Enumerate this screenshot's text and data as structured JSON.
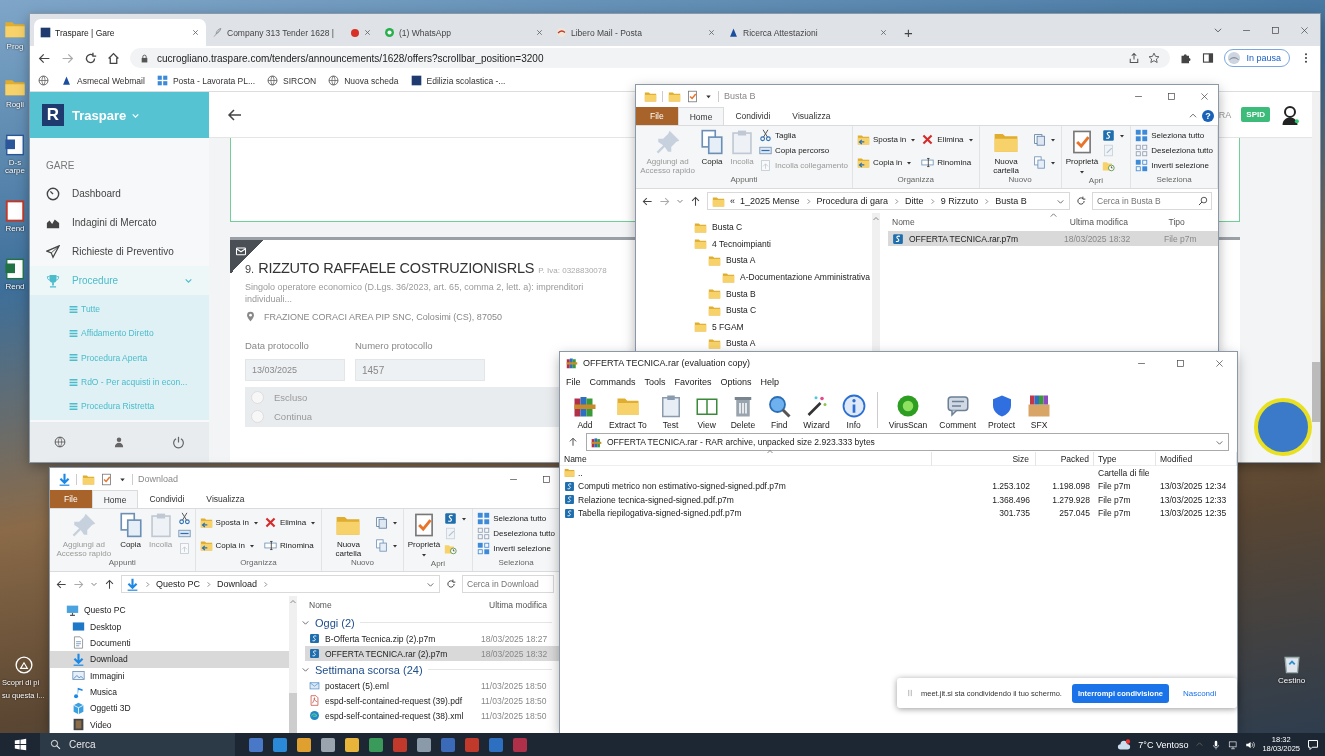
{
  "desktop": {
    "icons": [
      {
        "label": "Prog"
      },
      {
        "label": "Rogli"
      },
      {
        "label": "D-s carpe"
      },
      {
        "label": "Rend"
      },
      {
        "label": "Rend"
      }
    ],
    "spotlight": [
      "Scopri di pi",
      "su questa i..."
    ],
    "recycle_bin": "Cestino"
  },
  "browser": {
    "tabs": [
      {
        "title": "Traspare | Gare",
        "selected": true,
        "recording": false
      },
      {
        "title": "Company 313 Tender 1628 |",
        "selected": false,
        "recording": true
      },
      {
        "title": "(1) WhatsApp",
        "selected": false,
        "recording": false
      },
      {
        "title": "Libero Mail - Posta",
        "selected": false,
        "recording": false
      },
      {
        "title": "Ricerca Attestazioni",
        "selected": false,
        "recording": false
      }
    ],
    "new_tab": "+",
    "url": "cucrogliano.traspare.com/tenders/announcements/1628/offers?scrollbar_position=3200",
    "profile": "In pausa",
    "bookmarks": [
      "Asmecal Webmail",
      "Posta - Lavorata PL...",
      "SIRCON",
      "Nuova scheda",
      "Edilizia scolastica -..."
    ],
    "page": {
      "brand_mark": "R",
      "brand": "Traspare",
      "section": "GARE",
      "nav": [
        {
          "label": "Dashboard",
          "selected": false
        },
        {
          "label": "Indagini di Mercato",
          "selected": false
        },
        {
          "label": "Richieste di Preventivo",
          "selected": false
        },
        {
          "label": "Procedure",
          "selected": true,
          "expanded": true,
          "children": [
            {
              "label": "Tutte"
            },
            {
              "label": "Affidamento Diretto"
            },
            {
              "label": "Procedura Aperta"
            },
            {
              "label": "RdO - Per acquisti in econ..."
            },
            {
              "label": "Procedura Ristretta"
            }
          ]
        }
      ],
      "user": "RA",
      "badge": "SPID",
      "record": {
        "number": "9.",
        "name": "RIZZUTO RAFFAELE COSTRUZIONISRLS",
        "vat": "P. Iva: 0328830078",
        "subtitle": "Singolo operatore economico (D.Lgs. 36/2023, art. 65, comma 2, lett. a): imprenditori individuali...",
        "address": "FRAZIONE CORACI AREA PIP SNC, Colosimi (CS), 87050",
        "fields": [
          {
            "label": "Data protocollo",
            "value": "13/03/2025"
          },
          {
            "label": "Numero protocollo",
            "value": "1457"
          }
        ],
        "options": [
          {
            "label": "Escluso",
            "selected": false
          },
          {
            "label": "Continua",
            "selected": false
          }
        ]
      }
    }
  },
  "explorer_busta_b": {
    "title": "Busta B",
    "help": "?",
    "ribbon_tabs": [
      {
        "label": "File",
        "kind": "backstage",
        "selected": false
      },
      {
        "label": "Home",
        "kind": "tab",
        "selected": true
      },
      {
        "label": "Condividi",
        "kind": "tab",
        "selected": false
      },
      {
        "label": "Visualizza",
        "kind": "tab",
        "selected": false
      }
    ],
    "ribbon": [
      {
        "label": "Appunti",
        "items": [
          {
            "label": "Aggiungi ad Accesso rapido",
            "kind": "large",
            "disabled": true
          },
          {
            "label": "Copia",
            "kind": "large",
            "disabled": false
          },
          {
            "label": "Incolla",
            "kind": "large",
            "disabled": true
          },
          {
            "label": "Taglia",
            "kind": "small",
            "disabled": false
          },
          {
            "label": "Copia percorso",
            "kind": "small",
            "disabled": false
          },
          {
            "label": "Incolla collegamento",
            "kind": "small",
            "disabled": true
          }
        ]
      },
      {
        "label": "Organizza",
        "items": [
          {
            "label": "Sposta in",
            "kind": "small",
            "disabled": false,
            "dropdown": true
          },
          {
            "label": "Copia in",
            "kind": "small",
            "disabled": false,
            "dropdown": true
          },
          {
            "label": "Elimina",
            "kind": "small",
            "disabled": false,
            "dropdown": true
          },
          {
            "label": "Rinomina",
            "kind": "small",
            "disabled": false
          }
        ]
      },
      {
        "label": "Nuovo",
        "items": [
          {
            "label": "Nuova cartella",
            "kind": "large",
            "disabled": false
          },
          {
            "kind": "icon",
            "disabled": false,
            "dropdown": true
          },
          {
            "kind": "icon",
            "disabled": false,
            "dropdown": true
          }
        ]
      },
      {
        "label": "Apri",
        "items": [
          {
            "label": "Proprietà",
            "kind": "large",
            "disabled": false,
            "dropdown": true
          },
          {
            "kind": "icon",
            "disabled": false,
            "dropdown": true
          },
          {
            "kind": "icon",
            "disabled": true
          },
          {
            "kind": "icon",
            "disabled": false
          }
        ]
      },
      {
        "label": "Seleziona",
        "items": [
          {
            "label": "Seleziona tutto",
            "kind": "small",
            "disabled": false
          },
          {
            "label": "Deseleziona tutto",
            "kind": "small",
            "disabled": false
          },
          {
            "label": "Inverti selezione",
            "kind": "small",
            "disabled": false
          }
        ]
      }
    ],
    "path_overflow": "«",
    "path": [
      "1_2025 Mense",
      "Procedura di gara",
      "Ditte",
      "9 Rizzuto",
      "Busta B"
    ],
    "search_placeholder": "Cerca in Busta B",
    "tree": [
      {
        "label": "Busta C"
      },
      {
        "label": "4 Tecnoimpianti",
        "children": [
          {
            "label": "Busta A",
            "children": [
              {
                "label": "A-Documentazione Amministrativa"
              }
            ]
          },
          {
            "label": "Busta B"
          },
          {
            "label": "Busta C"
          }
        ]
      },
      {
        "label": "5 FGAM",
        "children": [
          {
            "label": "Busta A"
          }
        ]
      }
    ],
    "columns": [
      "Nome",
      "Ultima modifica",
      "Tipo"
    ],
    "files": [
      {
        "name": "OFFERTA TECNICA.rar.p7m",
        "modified": "18/03/2025 18:32",
        "type": "File p7m",
        "kind": "signed",
        "selected": true
      }
    ]
  },
  "archive": {
    "title": "OFFERTA TECNICA.rar (evaluation copy)",
    "menu": [
      "File",
      "Commands",
      "Tools",
      "Favorites",
      "Options",
      "Help"
    ],
    "tools": [
      {
        "label": "Add"
      },
      {
        "label": "Extract To"
      },
      {
        "label": "Test"
      },
      {
        "label": "View"
      },
      {
        "label": "Delete"
      },
      {
        "label": "Find"
      },
      {
        "label": "Wizard"
      },
      {
        "label": "Info"
      },
      {
        "label": "VirusScan"
      },
      {
        "label": "Comment"
      },
      {
        "label": "Protect"
      },
      {
        "label": "SFX"
      }
    ],
    "path": "OFFERTA TECNICA.rar - RAR archive, unpacked size 2.923.333 bytes",
    "columns": [
      "Name",
      "Size",
      "Packed",
      "Type",
      "Modified"
    ],
    "rows": [
      {
        "name": "..",
        "type": "Cartella di file",
        "kind": "folder"
      },
      {
        "name": "Computi metrico non estimativo-signed-signed.pdf.p7m",
        "size": "1.253.102",
        "packed": "1.198.098",
        "type": "File p7m",
        "modified": "13/03/2025 12:34",
        "kind": "signed"
      },
      {
        "name": "Relazione tecnica-signed-signed.pdf.p7m",
        "size": "1.368.496",
        "packed": "1.279.928",
        "type": "File p7m",
        "modified": "13/03/2025 12:33",
        "kind": "signed"
      },
      {
        "name": "Tabella riepilogativa-signed-signed.pdf.p7m",
        "size": "301.735",
        "packed": "257.045",
        "type": "File p7m",
        "modified": "13/03/2025 12:35",
        "kind": "signed"
      }
    ]
  },
  "explorer_download": {
    "title": "Download",
    "ribbon_tabs": [
      {
        "label": "File",
        "kind": "backstage",
        "selected": false
      },
      {
        "label": "Home",
        "kind": "tab",
        "selected": true
      },
      {
        "label": "Condividi",
        "kind": "tab",
        "selected": false
      },
      {
        "label": "Visualizza",
        "kind": "tab",
        "selected": false
      }
    ],
    "ribbon": [
      {
        "label": "Appunti",
        "items": [
          {
            "label": "Aggiungi ad Accesso rapido",
            "kind": "large",
            "disabled": true
          },
          {
            "label": "Copia",
            "kind": "large",
            "disabled": false
          },
          {
            "label": "Incolla",
            "kind": "large",
            "disabled": true
          },
          {
            "kind": "icon",
            "disabled": false
          },
          {
            "kind": "icon",
            "disabled": false
          },
          {
            "kind": "icon",
            "disabled": true
          }
        ]
      },
      {
        "label": "Organizza",
        "items": [
          {
            "label": "Sposta in",
            "kind": "small",
            "disabled": false,
            "dropdown": true
          },
          {
            "label": "Copia in",
            "kind": "small",
            "disabled": false,
            "dropdown": true
          },
          {
            "label": "Elimina",
            "kind": "small",
            "disabled": false,
            "dropdown": true
          },
          {
            "label": "Rinomina",
            "kind": "small",
            "disabled": false
          }
        ]
      },
      {
        "label": "Nuovo",
        "items": [
          {
            "label": "Nuova cartella",
            "kind": "large",
            "disabled": false
          },
          {
            "kind": "icon",
            "disabled": false,
            "dropdown": true
          },
          {
            "kind": "icon",
            "disabled": false,
            "dropdown": true
          }
        ]
      },
      {
        "label": "Apri",
        "items": [
          {
            "label": "Proprietà",
            "kind": "large",
            "disabled": false,
            "dropdown": true
          },
          {
            "kind": "icon",
            "disabled": false,
            "dropdown": true
          },
          {
            "kind": "icon",
            "disabled": true
          },
          {
            "kind": "icon",
            "disabled": false
          }
        ]
      },
      {
        "label": "Seleziona",
        "items": [
          {
            "label": "Seleziona tutto",
            "kind": "small",
            "disabled": false
          },
          {
            "label": "Deseleziona tutto",
            "kind": "small",
            "disabled": false
          },
          {
            "label": "Inverti selezione",
            "kind": "small",
            "disabled": false
          }
        ]
      }
    ],
    "path": [
      "Questo PC",
      "Download"
    ],
    "search_placeholder": "Cerca in Download",
    "nav": [
      {
        "label": "Questo PC",
        "selected": false,
        "children": [
          {
            "label": "Desktop",
            "selected": false
          },
          {
            "label": "Documenti",
            "selected": false
          },
          {
            "label": "Download",
            "selected": true
          },
          {
            "label": "Immagini",
            "selected": false
          },
          {
            "label": "Musica",
            "selected": false
          },
          {
            "label": "Oggetti 3D",
            "selected": false
          },
          {
            "label": "Video",
            "selected": false
          }
        ]
      }
    ],
    "columns": [
      "Nome",
      "Ultima modifica"
    ],
    "groups": [
      {
        "label": "Oggi (2)",
        "expanded": true,
        "files": [
          {
            "name": "B-Offerta Tecnica.zip (2).p7m",
            "modified": "18/03/2025 18:27",
            "kind": "signed",
            "selected": false
          },
          {
            "name": "OFFERTA TECNICA.rar (2).p7m",
            "modified": "18/03/2025 18:32",
            "kind": "signed",
            "selected": true
          }
        ]
      },
      {
        "label": "Settimana scorsa (24)",
        "expanded": true,
        "files": [
          {
            "name": "postacert (5).eml",
            "modified": "11/03/2025 18:50",
            "kind": "eml",
            "selected": false
          },
          {
            "name": "espd-self-contained-request (39).pdf",
            "modified": "11/03/2025 18:50",
            "kind": "pdf",
            "selected": false
          },
          {
            "name": "espd-self-contained-request (38).xml",
            "modified": "11/03/2025 18:50",
            "kind": "xml",
            "selected": false
          }
        ]
      }
    ]
  },
  "share_bar": {
    "message": "meet.jit.si sta condividendo il tuo schermo.",
    "stop": "Interrompi condivisione",
    "hide": "Nascondi"
  },
  "taskbar": {
    "search_placeholder": "Cerca",
    "weather": "7°C Ventoso",
    "time": "18:32",
    "date": "18/03/2025"
  }
}
